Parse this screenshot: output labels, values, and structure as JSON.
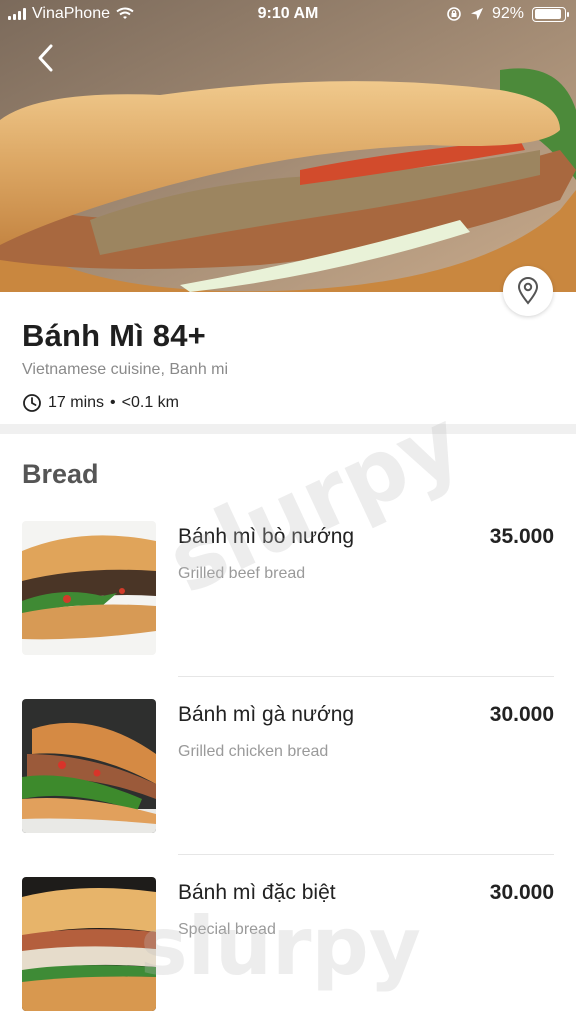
{
  "status_bar": {
    "carrier": "VinaPhone",
    "time": "9:10 AM",
    "battery_percent": "92%",
    "battery_level": 0.92
  },
  "restaurant": {
    "name": "Bánh Mì 84+",
    "cuisine": "Vietnamese cuisine, Banh mi",
    "delivery_time": "17 mins",
    "separator": "•",
    "distance": "<0.1 km"
  },
  "section": {
    "title": "Bread"
  },
  "menu_items": [
    {
      "name": "Bánh mì bò nướng",
      "description": "Grilled beef bread",
      "price": "35.000"
    },
    {
      "name": "Bánh mì gà nướng",
      "description": "Grilled chicken bread",
      "price": "30.000"
    },
    {
      "name": "Bánh mì đặc biệt",
      "description": "Special bread",
      "price": "30.000"
    }
  ],
  "watermark": {
    "text": "slurpy"
  },
  "icons": {
    "back": "chevron-left-icon",
    "pin": "map-pin-icon",
    "clock": "clock-icon",
    "wifi": "wifi-icon",
    "signal": "signal-icon",
    "battery": "battery-icon",
    "location": "location-arrow-icon",
    "lock": "rotation-lock-icon"
  },
  "colors": {
    "title": "#1f1f1f",
    "muted": "#8a8a8a",
    "section": "#555555",
    "divider": "#f0f0f0"
  }
}
